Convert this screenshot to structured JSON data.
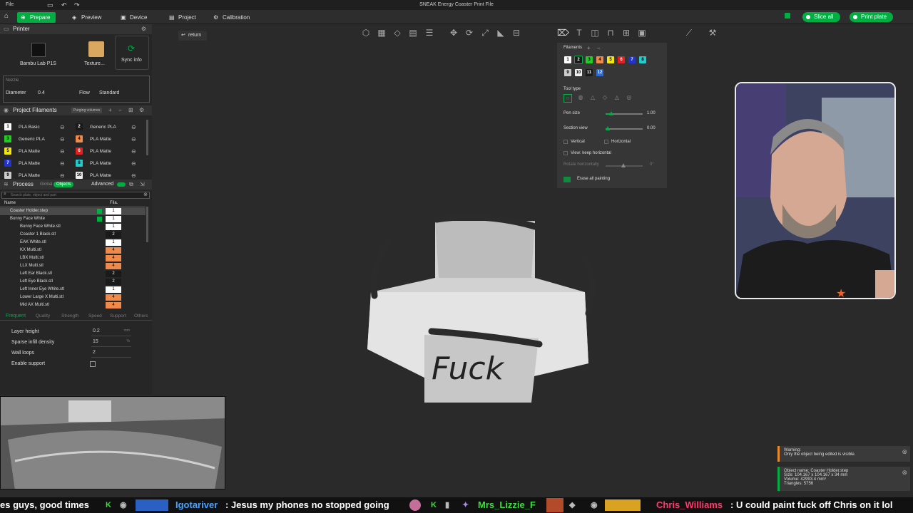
{
  "titlebar": {
    "file_menu": "File",
    "title": "SNEAK Energy Coaster Print File"
  },
  "toolbar": {
    "tabs": [
      {
        "label": "Prepare",
        "icon": "home-icon"
      },
      {
        "label": "Preview",
        "icon": "preview-icon"
      },
      {
        "label": "Device",
        "icon": "device-icon"
      },
      {
        "label": "Project",
        "icon": "project-icon"
      },
      {
        "label": "Calibration",
        "icon": "calibration-icon"
      }
    ],
    "slice_label": "Slice all",
    "print_label": "Print plate",
    "accent": "#00ae42"
  },
  "printer": {
    "header": "Printer",
    "printer_name": "Bambu Lab P1S",
    "plate_label": "Texture...",
    "sync_label": "Sync info",
    "nozzle_label": "Nozzle",
    "diameter_label": "Diameter",
    "diameter_value": "0.4",
    "flow_label": "Flow",
    "flow_value": "Standard"
  },
  "filaments": {
    "header": "Project Filaments",
    "purging_label": "Purging volumes",
    "items": [
      {
        "num": "1",
        "color": "#ffffff",
        "name": "PLA Basic"
      },
      {
        "num": "2",
        "color": "#1a1a1a",
        "name": "Generic PLA"
      },
      {
        "num": "3",
        "color": "#22cc22",
        "name": "Generic PLA"
      },
      {
        "num": "4",
        "color": "#f08a4b",
        "name": "PLA Matte"
      },
      {
        "num": "5",
        "color": "#f5e60a",
        "name": "PLA Matte"
      },
      {
        "num": "6",
        "color": "#e32020",
        "name": "PLA Matte"
      },
      {
        "num": "7",
        "color": "#2233cc",
        "name": "PLA Matte"
      },
      {
        "num": "8",
        "color": "#22cccc",
        "name": "PLA Matte"
      },
      {
        "num": "9",
        "color": "#cccccc",
        "name": "PLA Matte"
      },
      {
        "num": "10",
        "color": "#eeeeee",
        "name": "PLA Matte"
      }
    ]
  },
  "process": {
    "header": "Process",
    "global_label": "Global",
    "objects_label": "Objects",
    "advanced_label": "Advanced",
    "search_placeholder": "Search plate, object and part",
    "col_name": "Name",
    "col_fila": "Fila.",
    "objects": [
      {
        "name": "Coaster Holder.step",
        "fila": "1",
        "level": 0,
        "selected": true
      },
      {
        "name": "Bunny Face White",
        "fila": "1",
        "level": 0
      },
      {
        "name": "Bunny Face White.stl",
        "fila": "1",
        "level": 1
      },
      {
        "name": "Coaster 1 Black.stl",
        "fila": "2",
        "level": 1
      },
      {
        "name": "EAK White.stl",
        "fila": "1",
        "level": 1
      },
      {
        "name": "KX Multi.stl",
        "fila": "4",
        "level": 1
      },
      {
        "name": "LBX Multi.stl",
        "fila": "4",
        "level": 1
      },
      {
        "name": "LLX Multi.stl",
        "fila": "4",
        "level": 1
      },
      {
        "name": "Left Ear Black.stl",
        "fila": "2",
        "level": 1
      },
      {
        "name": "Left Eye Black.stl",
        "fila": "2",
        "level": 1
      },
      {
        "name": "Left Inner Eye White.stl",
        "fila": "1",
        "level": 1
      },
      {
        "name": "Lower Large X Multi.stl",
        "fila": "4",
        "level": 1
      },
      {
        "name": "Mid AX Multi.stl",
        "fila": "4",
        "level": 1
      }
    ],
    "tabs": [
      "Frequent",
      "Quality",
      "Strength",
      "Speed",
      "Support",
      "Others"
    ],
    "params": [
      {
        "label": "Layer height",
        "value": "0.2",
        "unit": "mm"
      },
      {
        "label": "Sparse infill density",
        "value": "15",
        "unit": "%"
      },
      {
        "label": "Wall loops",
        "value": "2",
        "unit": ""
      },
      {
        "label": "Enable support",
        "value": "",
        "unit": ""
      }
    ]
  },
  "viewport": {
    "return_label": "return",
    "model_text": "Fuck"
  },
  "paint": {
    "filaments_label": "Filaments",
    "colors": [
      {
        "num": "1",
        "color": "#ffffff"
      },
      {
        "num": "2",
        "color": "#1a1a1a"
      },
      {
        "num": "3",
        "color": "#22cc22"
      },
      {
        "num": "4",
        "color": "#f08a4b"
      },
      {
        "num": "5",
        "color": "#f5e60a"
      },
      {
        "num": "6",
        "color": "#e32020"
      },
      {
        "num": "7",
        "color": "#2233cc"
      },
      {
        "num": "8",
        "color": "#22cccc"
      },
      {
        "num": "9",
        "color": "#cccccc"
      },
      {
        "num": "10",
        "color": "#eeeeee"
      },
      {
        "num": "11",
        "color": "#1a1a1a"
      },
      {
        "num": "12",
        "color": "#2a6bd6"
      }
    ],
    "tool_type_label": "Tool type",
    "pen_size_label": "Pen size",
    "pen_size_value": "1.00",
    "section_view_label": "Section view",
    "section_view_value": "0.00",
    "vertical_label": "Vertical",
    "horizontal_label": "Horizontal",
    "keep_horizontal_label": "View: keep horizontal",
    "rotate_label": "Rotate horizontally",
    "rotate_value": "0°",
    "erase_label": "Erase all painting"
  },
  "notifications": {
    "warning_title": "Warning:",
    "warning_text": "Only the object being edited is visible.",
    "object_name": "Object name: Coaster Holder.step",
    "size": "Size: 104.167 x 104.167 x 34 mm",
    "volume": "Volume: 42993.4 mm³",
    "triangles": "Triangles: 5756"
  },
  "ticker": {
    "segments": [
      {
        "text": "es guys, good times",
        "color": "#ffffff"
      },
      {
        "text": "Igotariver",
        "color": "#4aa3ff"
      },
      {
        "text": ": Jesus my phones no stopped going",
        "color": "#ffffff"
      },
      {
        "text": "Mrs_Lizzie_F",
        "color": "#3ddc3d"
      },
      {
        "text": "Chris_Williams",
        "color": "#ff3b6b"
      },
      {
        "text": ": U could paint fuck off Chris on it lol",
        "color": "#ffffff"
      }
    ]
  }
}
